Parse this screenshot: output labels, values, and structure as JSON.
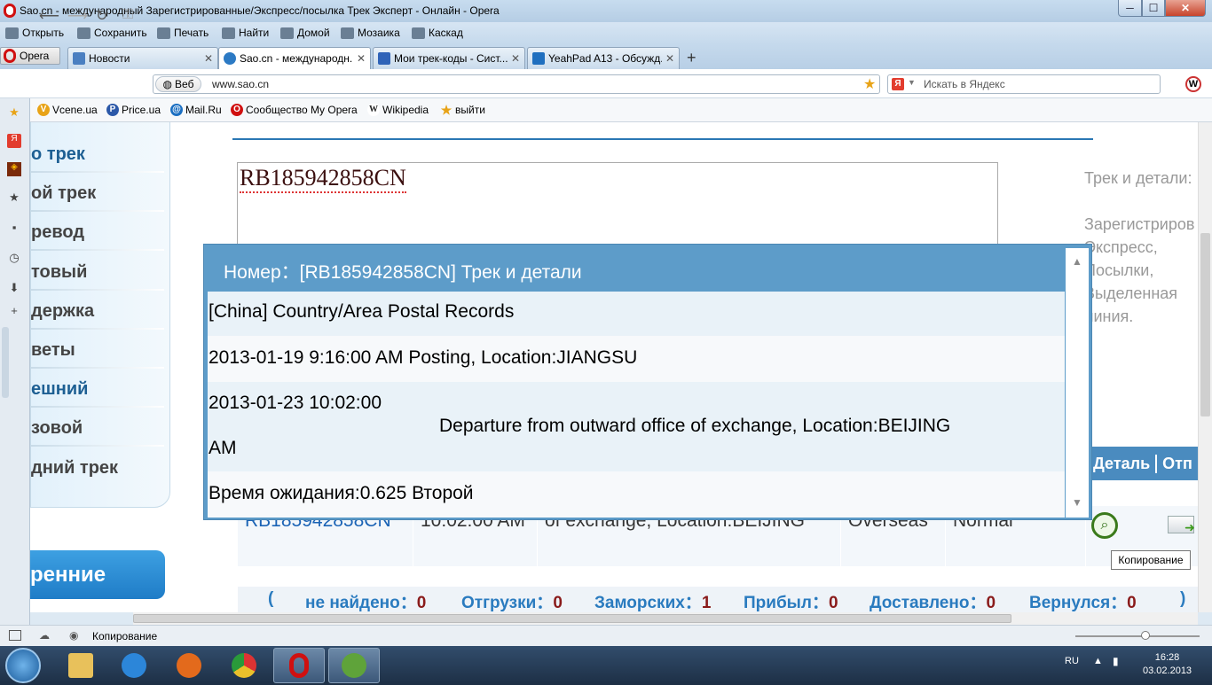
{
  "window": {
    "title": "Sao.cn - международный Зарегистрированные/Экспресс/посылка Трек Эксперт - Онлайн - Opera",
    "min": "─",
    "max": "☐",
    "close": "✕"
  },
  "menu": [
    {
      "label": "Открыть",
      "icon": "folder-icon"
    },
    {
      "label": "Сохранить",
      "icon": "save-icon"
    },
    {
      "label": "Печать",
      "icon": "print-icon"
    },
    {
      "label": "Найти",
      "icon": "search-icon"
    },
    {
      "label": "Домой",
      "icon": "home-icon"
    },
    {
      "label": "Мозаика",
      "icon": "tile-icon"
    },
    {
      "label": "Каскад",
      "icon": "cascade-icon"
    }
  ],
  "opera_button": "Opera",
  "tabs": [
    {
      "label": "Новости",
      "color": "#4a7fc1",
      "letter": "V"
    },
    {
      "label": "Sao.cn - международн...",
      "color": "#2c7ac4",
      "letter": "S"
    },
    {
      "label": "Мои трек-коды - Сист...",
      "color": "#2f63b8",
      "letter": "t"
    },
    {
      "label": "YeahPad A13 - Обсужд...",
      "color": "#1f6fbf",
      "letter": "4"
    }
  ],
  "new_tab": "+",
  "address": {
    "web_label": "Веб",
    "url": "www.sao.cn"
  },
  "search": {
    "placeholder": "Искать в Яндекс",
    "engine": "Я"
  },
  "bookmarks": [
    {
      "label": "Vcene.ua",
      "color": "#e8a317",
      "letter": "V"
    },
    {
      "label": "Price.ua",
      "color": "#2b58a8",
      "letter": "P"
    },
    {
      "label": "Mail.Ru",
      "color": "#1b6fc2",
      "letter": "@"
    },
    {
      "label": "Сообщество My Opera",
      "color": "#d01010",
      "letter": "O"
    },
    {
      "label": "Wikipedia",
      "color": "#444444",
      "letter": "W"
    },
    {
      "label": "выйти",
      "color": "#e8a317",
      "letter": "★"
    }
  ],
  "leftnav": [
    {
      "label": "о трек",
      "highlight": true
    },
    {
      "label": "ой трек",
      "highlight": false
    },
    {
      "label": "ревод",
      "highlight": false
    },
    {
      "label": "товый",
      "highlight": false
    },
    {
      "label": "держка",
      "highlight": false
    },
    {
      "label": "веты",
      "highlight": false
    },
    {
      "label": "ешний",
      "highlight": true
    },
    {
      "label": "зовой",
      "highlight": false
    },
    {
      "label": "дний трек",
      "highlight": false
    }
  ],
  "leftbutton": "ренние",
  "track_input": "RB185942858CN",
  "right_info": "Трек и детали:\n\nЗарегистриров Экспресс, Посылки, Выделенная линия.",
  "table": {
    "head_detail": "Деталь",
    "head_send": "Отп",
    "row": {
      "code": "RB185942858CN",
      "time": "10:02:00 AM",
      "event": "of exchange, Location:BEIJING",
      "dest": "Overseas",
      "type": "Normal"
    }
  },
  "tooltip": "Копирование",
  "stats": {
    "open": "(",
    "not_found_label": "не найдено：",
    "not_found": "0",
    "shipments_label": "Отгрузки：",
    "shipments": "0",
    "overseas_label": "Заморских：",
    "overseas": "1",
    "arrived_label": "Прибыл：",
    "arrived": "0",
    "delivered_label": "Доставлено：",
    "delivered": "0",
    "returned_label": "Вернулся：",
    "returned": "0",
    "close": ")"
  },
  "modal": {
    "title": "Номер：[RB185942858CN] Трек и детали",
    "rows": [
      "[China]  Country/Area Postal Records",
      "2013-01-19 9:16:00 AM Posting, Location:JIANGSU"
    ],
    "row3_date": "2013-01-23 10:02:00",
    "row3_ampm": "AM",
    "row3_event": "Departure from outward office of exchange, Location:BEIJING",
    "wait": "Время ожидания:0.625 Второй"
  },
  "statusbar": "Копирование",
  "tray": {
    "lang": "RU",
    "time": "16:28",
    "date": "03.02.2013"
  }
}
